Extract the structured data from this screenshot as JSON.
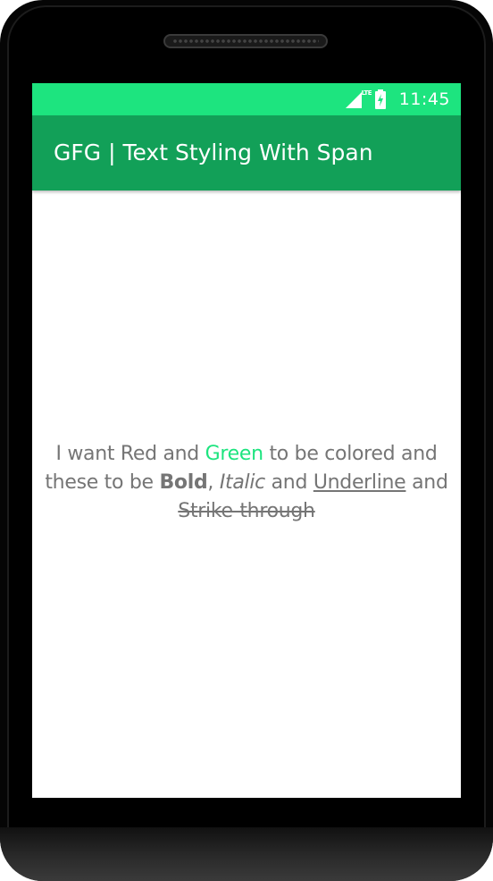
{
  "status_bar": {
    "network": "LTE",
    "time": "11:45",
    "icons": [
      "lte-signal-icon",
      "battery-charging-icon"
    ],
    "color": "#1de47f"
  },
  "app_bar": {
    "title": "GFG | Text Styling With Span",
    "color": "#12a058"
  },
  "content": {
    "segments": {
      "s1": "I want Red and ",
      "green": "Green",
      "s2": " to be colored and these to be ",
      "bold": "Bold",
      "s3": ", ",
      "italic": "Italic",
      "s4": " and ",
      "underline": "Underline",
      "s5": " and ",
      "strike": "Strike-through"
    },
    "text_color": "#757575",
    "green_color": "#1de47f"
  }
}
